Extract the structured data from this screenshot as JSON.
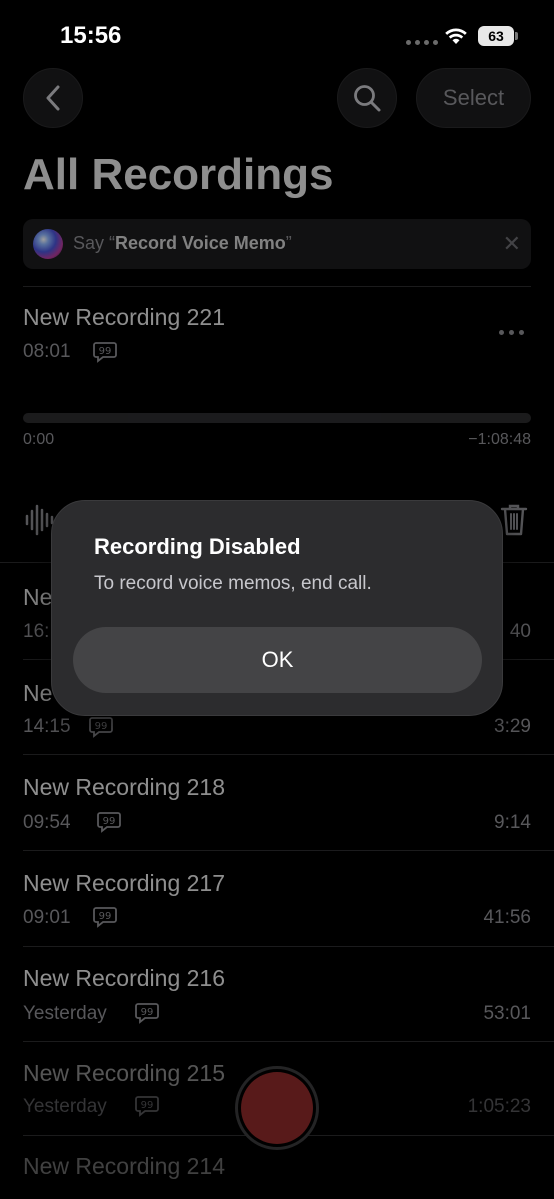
{
  "status_bar": {
    "time": "15:56",
    "battery": "63"
  },
  "header": {
    "select_label": "Select",
    "title": "All Recordings"
  },
  "siri_banner": {
    "prefix": "Say “",
    "phrase": "Record Voice Memo",
    "suffix": "”"
  },
  "expanded": {
    "title": "New Recording 221",
    "date": "08:01",
    "current_time": "0:00",
    "remaining_time": "−1:08:48"
  },
  "recordings": [
    {
      "title": "Ne",
      "date": "16:",
      "duration": "40"
    },
    {
      "title": "Ne",
      "date": "14:15",
      "duration": "3:29"
    },
    {
      "title": "New Recording 218",
      "date": "09:54",
      "duration": "9:14"
    },
    {
      "title": "New Recording 217",
      "date": "09:01",
      "duration": "41:56"
    },
    {
      "title": "New Recording 216",
      "date": "Yesterday",
      "duration": "53:01"
    },
    {
      "title": "New Recording 215",
      "date": "Yesterday",
      "duration": "1:05:23"
    },
    {
      "title": "New Recording 214",
      "date": "",
      "duration": ""
    }
  ],
  "alert": {
    "title": "Recording Disabled",
    "message": "To record voice memos, end call.",
    "ok_label": "OK"
  },
  "colors": {
    "record": "#8e2a2a",
    "background": "#000000",
    "alert_bg": "#2c2c2e"
  },
  "icons": [
    "back-chevron-icon",
    "search-icon",
    "siri-icon",
    "close-icon",
    "transcript-icon",
    "more-icon",
    "waveform-icon",
    "trash-icon",
    "wifi-icon",
    "battery-icon"
  ]
}
